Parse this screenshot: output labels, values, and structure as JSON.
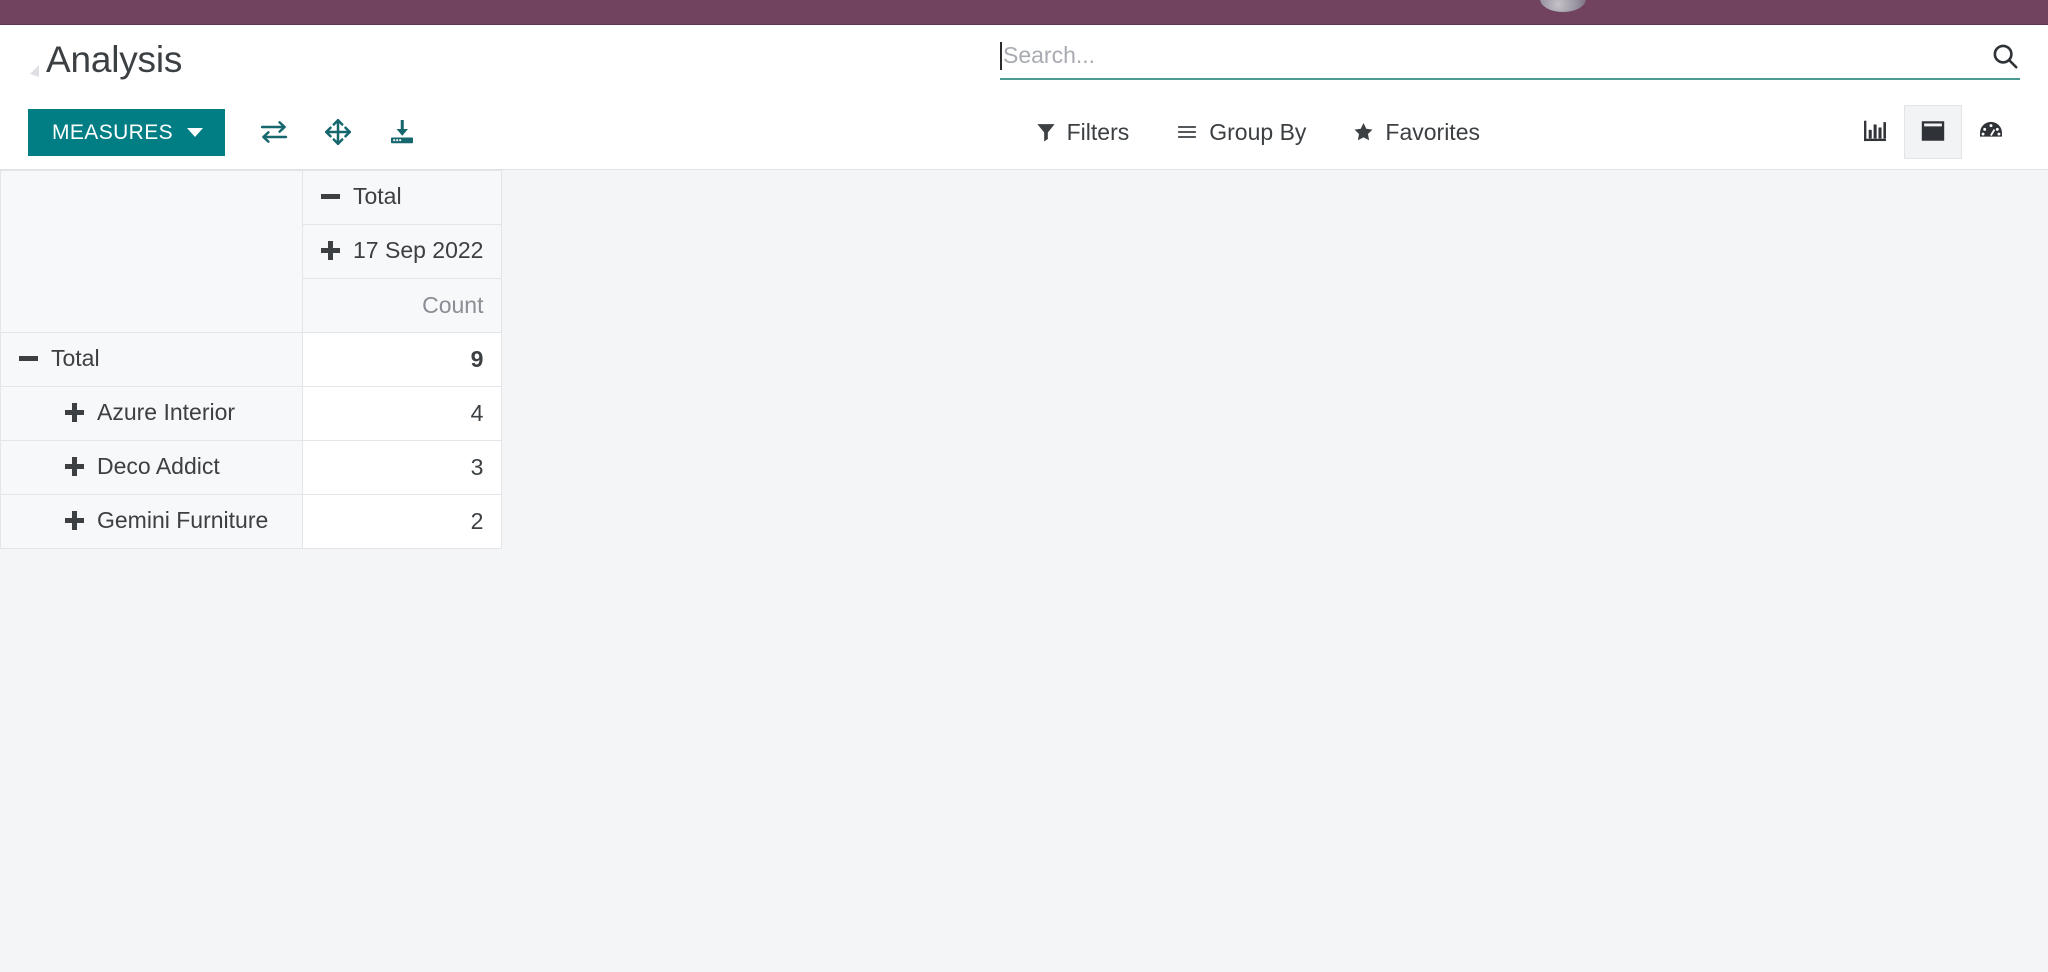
{
  "window": {
    "topbar_color": "#71435f",
    "accent_color": "#017e84",
    "background_color": "#f4f5f7"
  },
  "control_panel": {
    "breadcrumb": "Analysis",
    "search": {
      "placeholder": "Search...",
      "value": "",
      "icon": "search-icon",
      "underline_color": "#4b9b93"
    },
    "measures_button": {
      "label": "MEASURES",
      "caret_icon": "chevron-down-icon"
    },
    "pivot_tools": [
      {
        "name": "flip-axis-icon",
        "title": "Flip axis"
      },
      {
        "name": "expand-all-icon",
        "title": "Expand all"
      },
      {
        "name": "download-xlsx-icon",
        "title": "Download xlsx"
      }
    ],
    "filter_menus": [
      {
        "label": "Filters",
        "icon": "filter-funnel-icon"
      },
      {
        "label": "Group By",
        "icon": "bars-icon"
      },
      {
        "label": "Favorites",
        "icon": "star-icon"
      }
    ],
    "view_switcher": {
      "views": [
        {
          "name": "graph-view-icon",
          "label": "Graph",
          "active": false
        },
        {
          "name": "pivot-view-icon",
          "label": "Pivot",
          "active": true
        },
        {
          "name": "dashboard-gauge-icon",
          "label": "Dashboard",
          "active": false
        }
      ]
    }
  },
  "pivot": {
    "corner_label": "",
    "column_group": {
      "total_label": "Total",
      "total_state": "expanded",
      "child_label": "17 Sep 2022",
      "child_state": "collapsed",
      "measure_label": "Count"
    },
    "rows": [
      {
        "label": "Total",
        "state": "expanded",
        "indent": 0,
        "value": "9",
        "is_total": true
      },
      {
        "label": "Azure Interior",
        "state": "collapsed",
        "indent": 1,
        "value": "4",
        "is_total": false
      },
      {
        "label": "Deco Addict",
        "state": "collapsed",
        "indent": 1,
        "value": "3",
        "is_total": false
      },
      {
        "label": "Gemini Furniture",
        "state": "collapsed",
        "indent": 1,
        "value": "2",
        "is_total": false
      }
    ]
  },
  "chart_data": {
    "type": "table",
    "title": "Analysis",
    "columns": [
      "Total / 17 Sep 2022 - Count"
    ],
    "categories": [
      "Total",
      "Azure Interior",
      "Deco Addict",
      "Gemini Furniture"
    ],
    "values": [
      9,
      4,
      3,
      2
    ],
    "measure": "Count",
    "column_header": "17 Sep 2022",
    "xlabel": "",
    "ylabel": "Count"
  }
}
